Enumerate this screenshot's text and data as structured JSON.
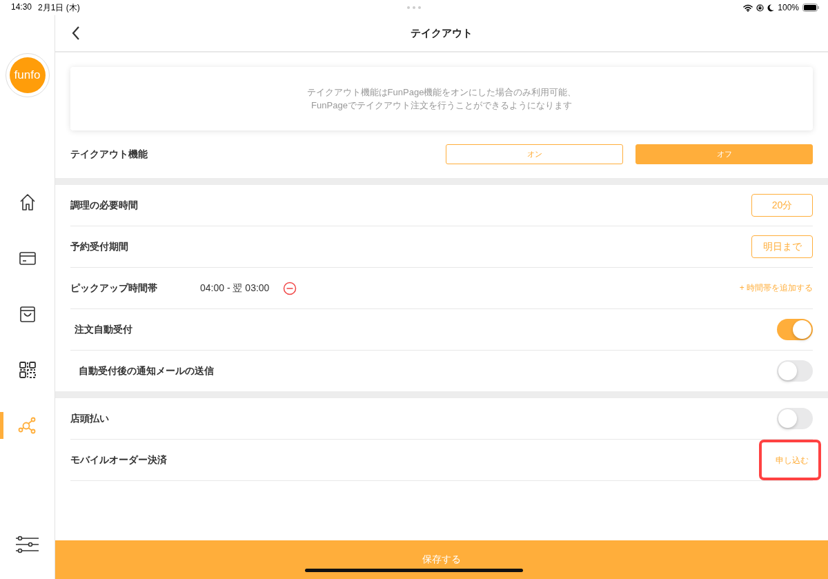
{
  "status_bar": {
    "time": "14:30",
    "date": "2月1日 (木)",
    "battery": "100%"
  },
  "sidebar": {
    "logo": "funfo",
    "items": [
      {
        "kind": "home",
        "selected": false
      },
      {
        "kind": "card",
        "selected": false
      },
      {
        "kind": "bag",
        "selected": false
      },
      {
        "kind": "qr",
        "selected": false
      },
      {
        "kind": "network",
        "selected": true
      },
      {
        "kind": "sliders",
        "selected": false
      }
    ]
  },
  "header": {
    "title": "テイクアウト"
  },
  "notice": [
    "テイクアウト機能はFunPage機能をオンにした場合のみ利用可能、",
    "FunPageでテイクアウト注文を行うことができるようになります"
  ],
  "takeout_feature": {
    "label": "テイクアウト機能",
    "options": [
      {
        "label": "オン",
        "selected": false
      },
      {
        "label": "オフ",
        "selected": true
      }
    ]
  },
  "sections": [
    {
      "rows": [
        {
          "kind": "value",
          "label": "調理の必要時間",
          "value": "20分"
        },
        {
          "kind": "value",
          "label": "予約受付期間",
          "value": "明日まで"
        },
        {
          "kind": "timeslot",
          "label": "ピックアップ時間帯",
          "range": "04:00 - 翌 03:00",
          "add_link": "+ 時間帯を追加する"
        },
        {
          "kind": "toggle",
          "label": "注文自動受付",
          "on": true,
          "indented": true
        },
        {
          "kind": "toggle",
          "label": "自動受付後の通知メールの送信",
          "on": false,
          "indented": true
        }
      ]
    },
    {
      "rows": [
        {
          "kind": "toggle",
          "label": "店頭払い",
          "on": false
        },
        {
          "kind": "link",
          "label": "モバイルオーダー決済",
          "link": "申し込む",
          "highlighted": true
        }
      ]
    }
  ],
  "save_button": "保存する"
}
